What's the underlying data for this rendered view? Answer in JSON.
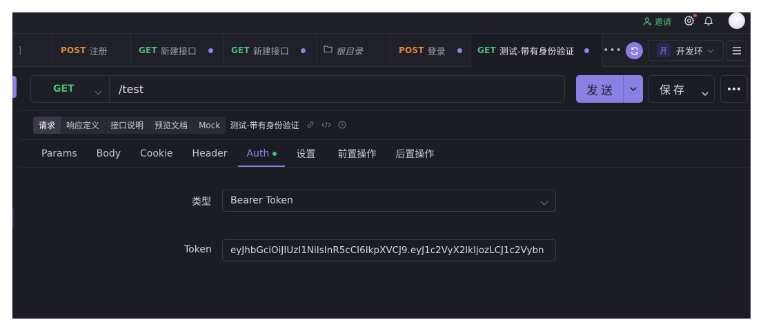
{
  "topbar": {
    "invite_label": "邀请",
    "icons": [
      "user-add-icon",
      "gear-icon",
      "bell-icon"
    ]
  },
  "tabs": [
    {
      "method": "",
      "name": "",
      "partial_glyph": "]"
    },
    {
      "method": "POST",
      "name": "注册",
      "dirty": false
    },
    {
      "method": "GET",
      "name": "新建接口",
      "dirty": true
    },
    {
      "method": "GET",
      "name": "新建接口",
      "dirty": true
    },
    {
      "method": "",
      "name": "根目录",
      "icon": "folder-icon",
      "dirty": false
    },
    {
      "method": "POST",
      "name": "登录",
      "dirty": true
    },
    {
      "method": "GET",
      "name": "测试-带有身份验证",
      "dirty": true,
      "active": true
    }
  ],
  "tabbar": {
    "more_label": "•••",
    "env_badge": "开",
    "env_name": "开发环"
  },
  "request": {
    "method": "GET",
    "url": "/test",
    "send_label": "发送",
    "save_label": "保存"
  },
  "subtabs": {
    "items": [
      "请求",
      "响应定义",
      "接口说明",
      "预览文档",
      "Mock"
    ],
    "active": "请求",
    "api_title": "测试-带有身份验证"
  },
  "param_tabs": {
    "items": [
      "Params",
      "Body",
      "Cookie",
      "Header",
      "Auth",
      "设置",
      "前置操作",
      "后置操作"
    ],
    "active": "Auth"
  },
  "auth": {
    "type_label": "类型",
    "type_value": "Bearer Token",
    "token_label": "Token",
    "token_value": "eyJhbGciOiJIUzI1NiIsInR5cCI6IkpXVCJ9.eyJ1c2VyX2lkIjozLCJ1c2Vybn"
  },
  "colors": {
    "accent": "#8a7fe3",
    "get": "#4dbd78",
    "post": "#e58a35",
    "background": "#1c1c24"
  }
}
